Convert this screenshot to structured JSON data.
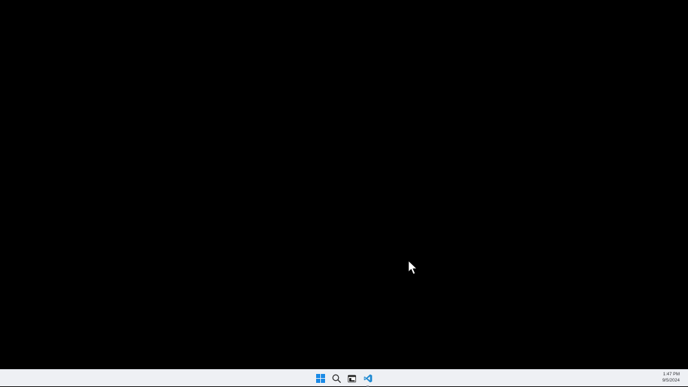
{
  "taskbar": {
    "apps": [
      {
        "name": "Start",
        "icon": "windows-logo-icon",
        "color": "#1a8ae6"
      },
      {
        "name": "Search",
        "icon": "search-icon",
        "color": "#2a2a2a"
      },
      {
        "name": "Terminal",
        "icon": "terminal-icon",
        "color": "#1f1f1f"
      },
      {
        "name": "Visual Studio Code",
        "icon": "vscode-icon",
        "color": "#1f8ad2"
      }
    ],
    "clock": {
      "time": "1:47 PM",
      "date": "9/5/2024"
    }
  },
  "colors": {
    "desktop_background": "#000000",
    "taskbar_background": "#eef0f4"
  }
}
